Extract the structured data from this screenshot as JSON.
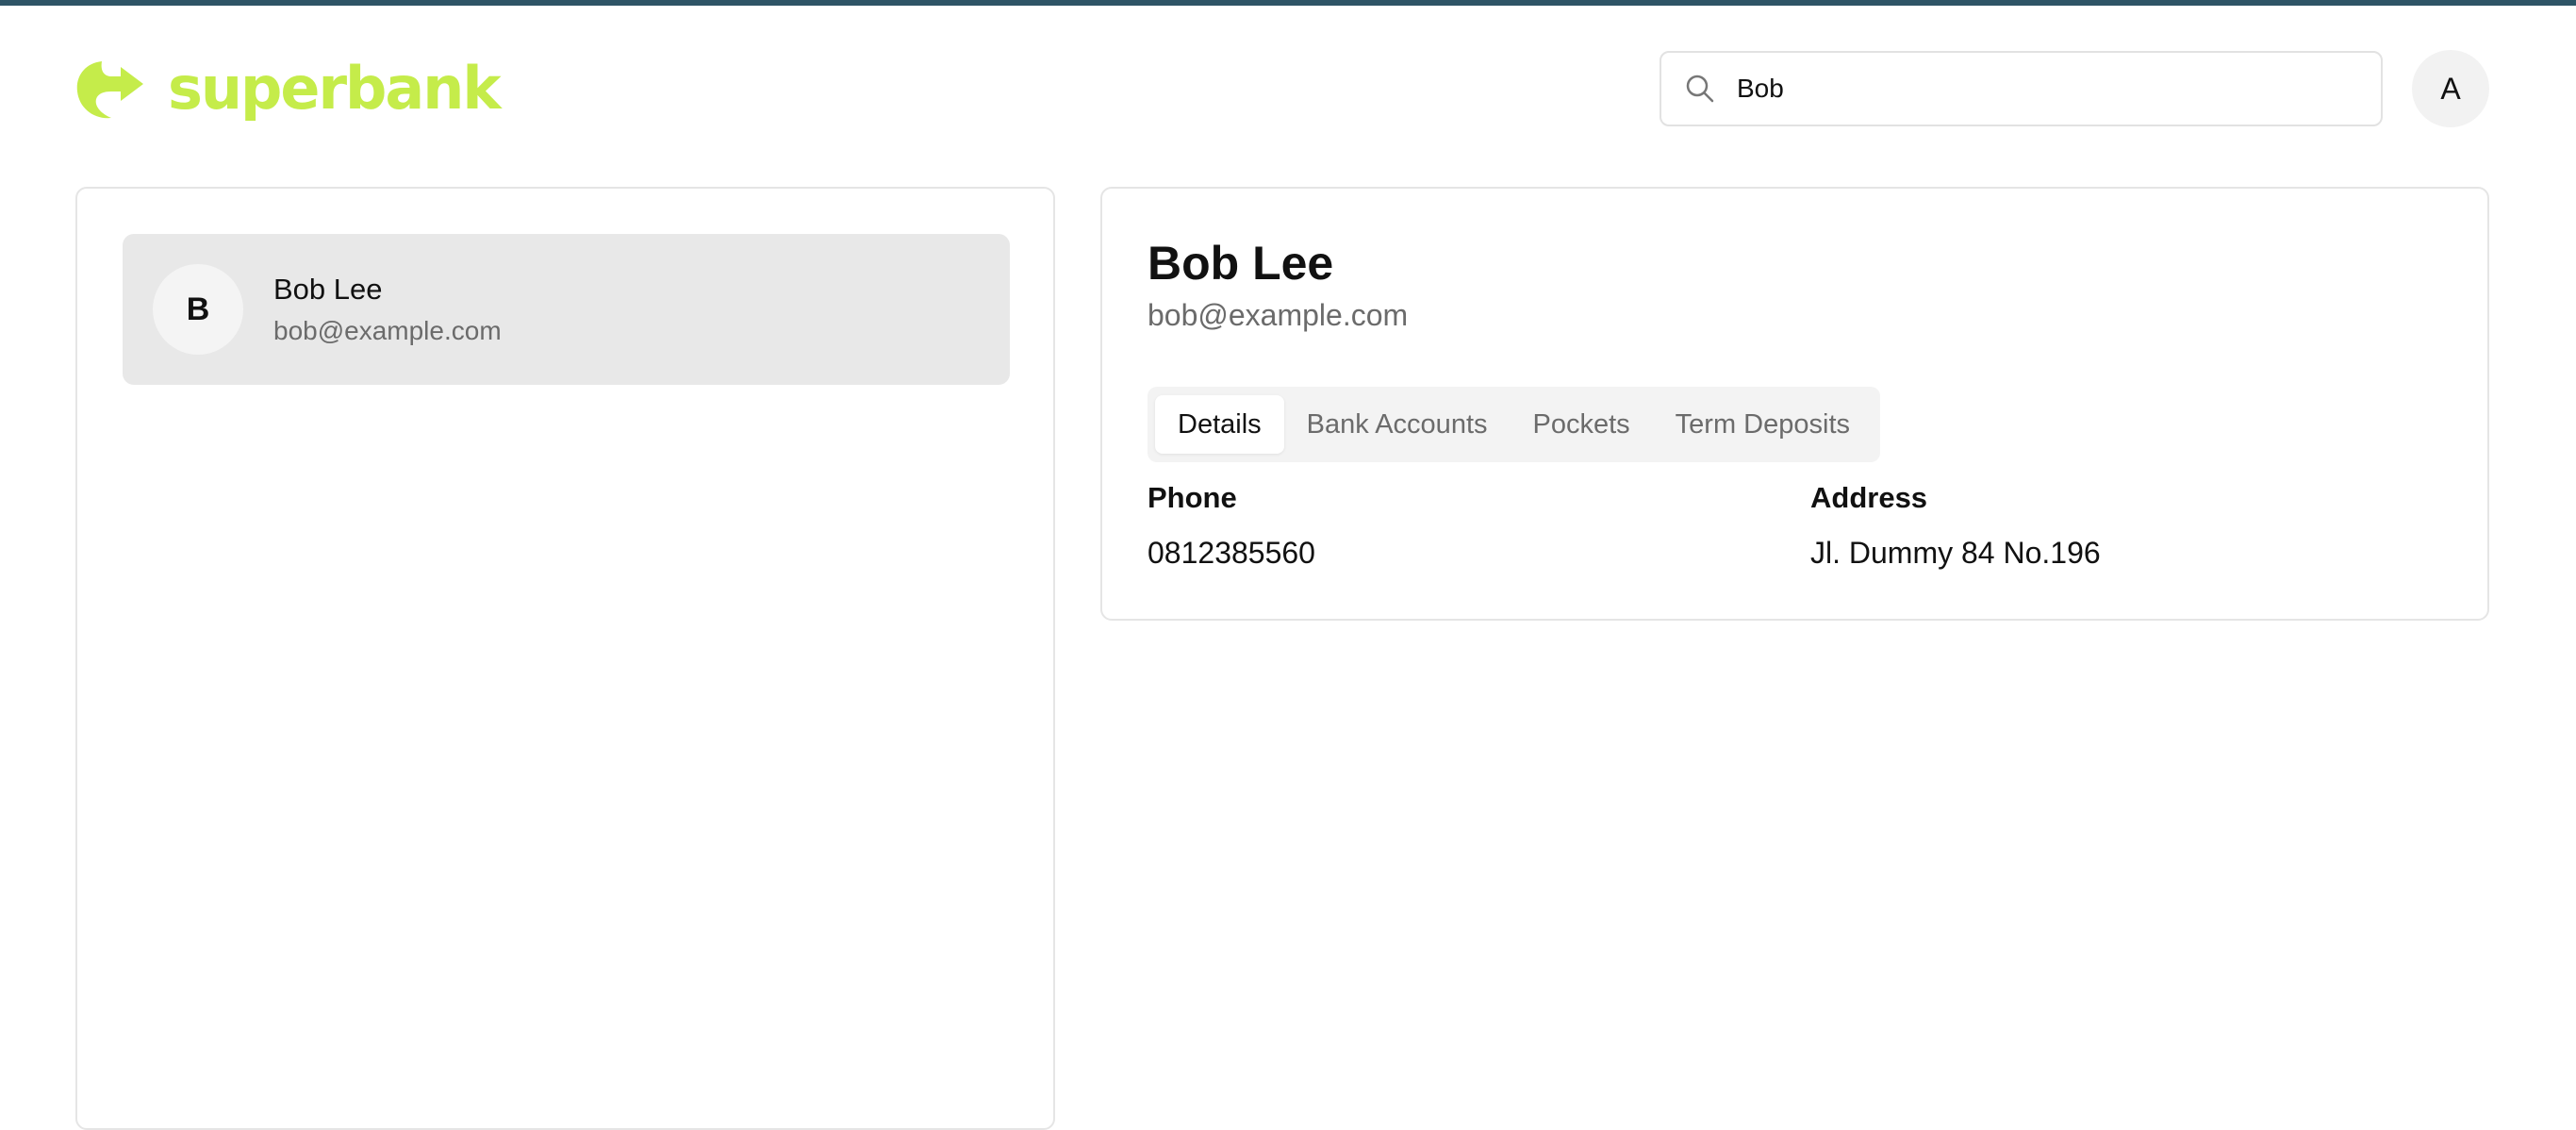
{
  "app": {
    "brand": "superbank",
    "brand_color": "#c5ec4a",
    "top_strip_color": "#2e5466"
  },
  "header": {
    "search": {
      "value": "Bob",
      "icon": "search-icon"
    },
    "user_avatar_initial": "A"
  },
  "customer_list": {
    "items": [
      {
        "initial": "B",
        "name": "Bob Lee",
        "email": "bob@example.com",
        "selected": true
      }
    ]
  },
  "customer_detail": {
    "name": "Bob Lee",
    "email": "bob@example.com",
    "tabs": [
      {
        "label": "Details",
        "active": true
      },
      {
        "label": "Bank Accounts",
        "active": false
      },
      {
        "label": "Pockets",
        "active": false
      },
      {
        "label": "Term Deposits",
        "active": false
      }
    ],
    "fields": {
      "phone": {
        "label": "Phone",
        "value": "0812385560"
      },
      "address": {
        "label": "Address",
        "value": "Jl. Dummy 84 No.196"
      }
    }
  }
}
